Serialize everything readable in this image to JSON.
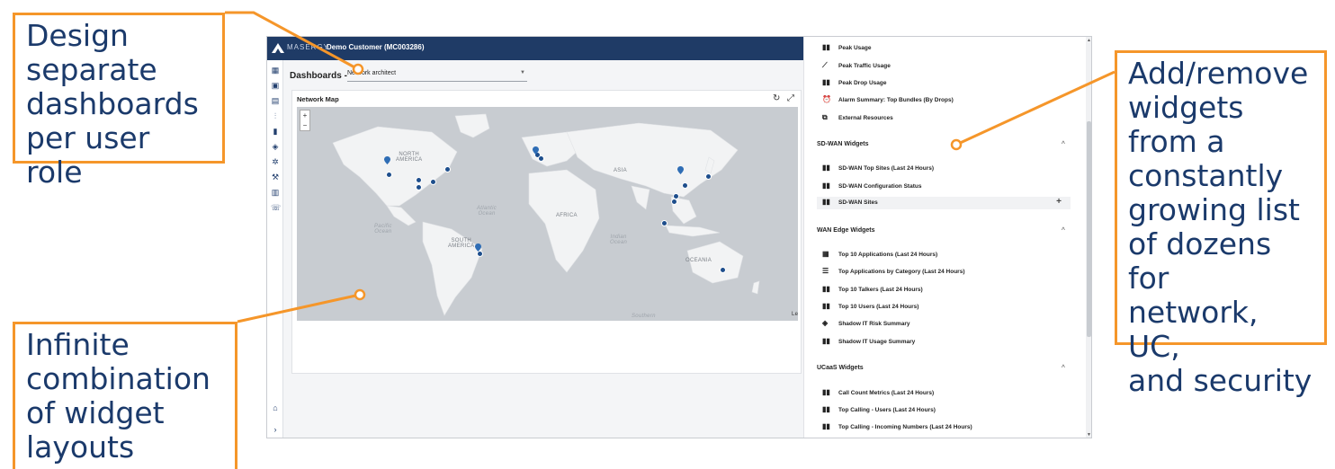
{
  "callouts": {
    "top_left": "Design\nseparate\ndashboards\nper user role",
    "right": "Add/remove\nwidgets\nfrom a\nconstantly\ngrowing list\nof dozens for\nnetwork, UC,\nand security",
    "bottom_left": "Infinite\ncombination\nof widget\nlayouts"
  },
  "header": {
    "brand": "MASERGY",
    "customer": "Demo Customer (MC003286)"
  },
  "dashboard": {
    "title": "Dashboards -",
    "selected": "Network architect"
  },
  "card": {
    "title": "Network Map",
    "refresh_icon": "refresh-icon",
    "expand_icon": "expand-icon"
  },
  "map": {
    "zoom_in": "+",
    "zoom_out": "−",
    "labels": {
      "north_america": "NORTH\nAMERICA",
      "south_america": "SOUTH\nAMERICA",
      "africa": "AFRICA",
      "asia": "ASIA",
      "oceania": "OCEANIA",
      "atlantic": "Atlantic\nOcean",
      "pacific": "Pacific\nOcean",
      "indian": "Indian\nOcean",
      "southern": "Southern",
      "attribution": "Le"
    }
  },
  "widgets": {
    "top_items": [
      {
        "icon": "bar-chart-icon",
        "label": "Peak Usage"
      },
      {
        "icon": "line-chart-icon",
        "label": "Peak Traffic Usage"
      },
      {
        "icon": "bar-chart-icon",
        "label": "Peak Drop Usage"
      },
      {
        "icon": "alarm-icon",
        "label": "Alarm Summary: Top Bundles (By Drops)"
      },
      {
        "icon": "external-link-icon",
        "label": "External Resources"
      }
    ],
    "sections": [
      {
        "title": "SD-WAN Widgets",
        "items": [
          {
            "icon": "bar-chart-icon",
            "label": "SD-WAN Top Sites (Last 24 Hours)"
          },
          {
            "icon": "bar-chart-icon",
            "label": "SD-WAN Configuration Status"
          },
          {
            "icon": "bar-chart-icon",
            "label": "SD-WAN Sites",
            "add": "+"
          }
        ]
      },
      {
        "title": "WAN Edge Widgets",
        "items": [
          {
            "icon": "grid-icon",
            "label": "Top 10 Applications (Last 24 Hours)"
          },
          {
            "icon": "list-icon",
            "label": "Top Applications by Category (Last 24 Hours)"
          },
          {
            "icon": "bar-chart-icon",
            "label": "Top 10 Talkers (Last 24 Hours)"
          },
          {
            "icon": "bar-chart-icon",
            "label": "Top 10 Users (Last 24 Hours)"
          },
          {
            "icon": "shield-icon",
            "label": "Shadow IT Risk Summary"
          },
          {
            "icon": "bar-chart-icon",
            "label": "Shadow IT Usage Summary"
          }
        ]
      },
      {
        "title": "UCaaS Widgets",
        "items": [
          {
            "icon": "bar-chart-icon",
            "label": "Call Count Metrics (Last 24 Hours)"
          },
          {
            "icon": "bar-chart-icon",
            "label": "Top Calling - Users (Last 24 Hours)"
          },
          {
            "icon": "bar-chart-icon",
            "label": "Top Calling - Incoming Numbers (Last 24 Hours)"
          }
        ]
      }
    ]
  },
  "colors": {
    "accent_orange": "#f5962a",
    "navy": "#1f3b66",
    "callout_text": "#1b3a6b"
  }
}
